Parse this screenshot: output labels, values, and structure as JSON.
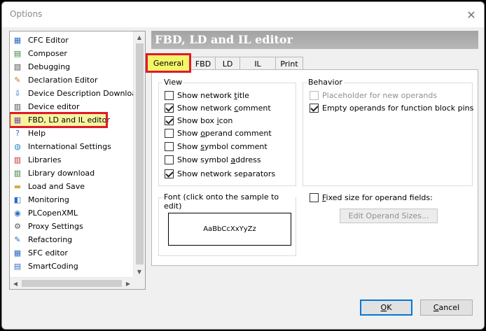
{
  "window": {
    "title": "Options",
    "close_label": "✕"
  },
  "tree": {
    "items": [
      {
        "label": "CFC Editor",
        "icon": "cfc-editor-icon",
        "selected": false
      },
      {
        "label": "Composer",
        "icon": "composer-icon",
        "selected": false
      },
      {
        "label": "Debugging",
        "icon": "debugging-icon",
        "selected": false
      },
      {
        "label": "Declaration Editor",
        "icon": "declaration-editor-icon",
        "selected": false
      },
      {
        "label": "Device Description Download",
        "icon": "download-icon",
        "selected": false
      },
      {
        "label": "Device editor",
        "icon": "device-editor-icon",
        "selected": false
      },
      {
        "label": "FBD, LD and IL editor",
        "icon": "fbd-ld-il-editor-icon",
        "selected": true
      },
      {
        "label": "Help",
        "icon": "help-icon",
        "selected": false
      },
      {
        "label": "International Settings",
        "icon": "globe-icon",
        "selected": false
      },
      {
        "label": "Libraries",
        "icon": "libraries-icon",
        "selected": false
      },
      {
        "label": "Library download",
        "icon": "library-download-icon",
        "selected": false
      },
      {
        "label": "Load and Save",
        "icon": "folder-icon",
        "selected": false
      },
      {
        "label": "Monitoring",
        "icon": "monitoring-icon",
        "selected": false
      },
      {
        "label": "PLCopenXML",
        "icon": "plcopenxml-icon",
        "selected": false
      },
      {
        "label": "Proxy Settings",
        "icon": "proxy-settings-icon",
        "selected": false
      },
      {
        "label": "Refactoring",
        "icon": "refactoring-icon",
        "selected": false
      },
      {
        "label": "SFC editor",
        "icon": "sfc-editor-icon",
        "selected": false
      },
      {
        "label": "SmartCoding",
        "icon": "smartcoding-icon",
        "selected": false
      }
    ]
  },
  "panel": {
    "header": "FBD, LD and IL editor",
    "tabs": [
      "General",
      "FBD",
      "LD",
      "IL",
      "Print"
    ],
    "active_tab": "General",
    "view_group": {
      "title": "View",
      "options": [
        {
          "pre": "Show network ",
          "u": "t",
          "post": "itle",
          "checked": false
        },
        {
          "pre": "Show network ",
          "u": "c",
          "post": "omment",
          "checked": true
        },
        {
          "pre": "Show box ",
          "u": "i",
          "post": "con",
          "checked": true
        },
        {
          "pre": "Show ",
          "u": "o",
          "post": "perand comment",
          "checked": false
        },
        {
          "pre": "Show ",
          "u": "s",
          "post": "ymbol comment",
          "checked": false
        },
        {
          "pre": "Show symbol ",
          "u": "a",
          "post": "ddress",
          "checked": false
        },
        {
          "pre": "Show network separators",
          "u": "",
          "post": "",
          "checked": true
        }
      ]
    },
    "behavior_group": {
      "title": "Behavior",
      "options": [
        {
          "label": "Placeholder for new operands",
          "checked": false,
          "disabled": true
        },
        {
          "label": "Empty operands for function block pins",
          "checked": true,
          "disabled": false
        }
      ]
    },
    "font_group": {
      "title": "Font (click onto the sample to edit)",
      "sample": "AaBbCcXxYyZz"
    },
    "fixed_size": {
      "pre": "",
      "u": "F",
      "post": "ixed size for operand fields:",
      "checked": false
    },
    "edit_sizes_button": "Edit Operand Sizes..."
  },
  "buttons": {
    "ok": {
      "u": "O",
      "post": "K"
    },
    "cancel": {
      "u": "C",
      "post": "ancel"
    }
  }
}
